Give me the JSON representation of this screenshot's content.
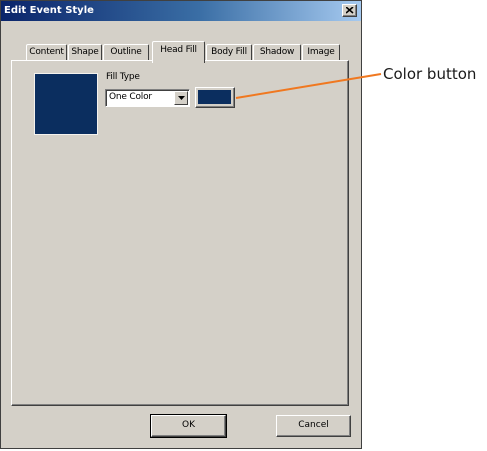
{
  "window": {
    "title": "Edit Event Style",
    "close_glyph": "close-icon"
  },
  "tabs": [
    {
      "label": "Content",
      "active": false
    },
    {
      "label": "Shape",
      "active": false
    },
    {
      "label": "Outline",
      "active": false
    },
    {
      "label": "Head Fill",
      "active": true
    },
    {
      "label": "Body Fill",
      "active": false
    },
    {
      "label": "Shadow",
      "active": false
    },
    {
      "label": "Image",
      "active": false
    }
  ],
  "head_fill": {
    "preview_color": "#0b2e5f",
    "fill_type_label": "Fill Type",
    "fill_type_value": "One Color",
    "color_button_color": "#0b2e5f"
  },
  "buttons": {
    "ok": "OK",
    "cancel": "Cancel"
  },
  "annotation": {
    "text": "Color button",
    "line_color": "#f07820"
  }
}
